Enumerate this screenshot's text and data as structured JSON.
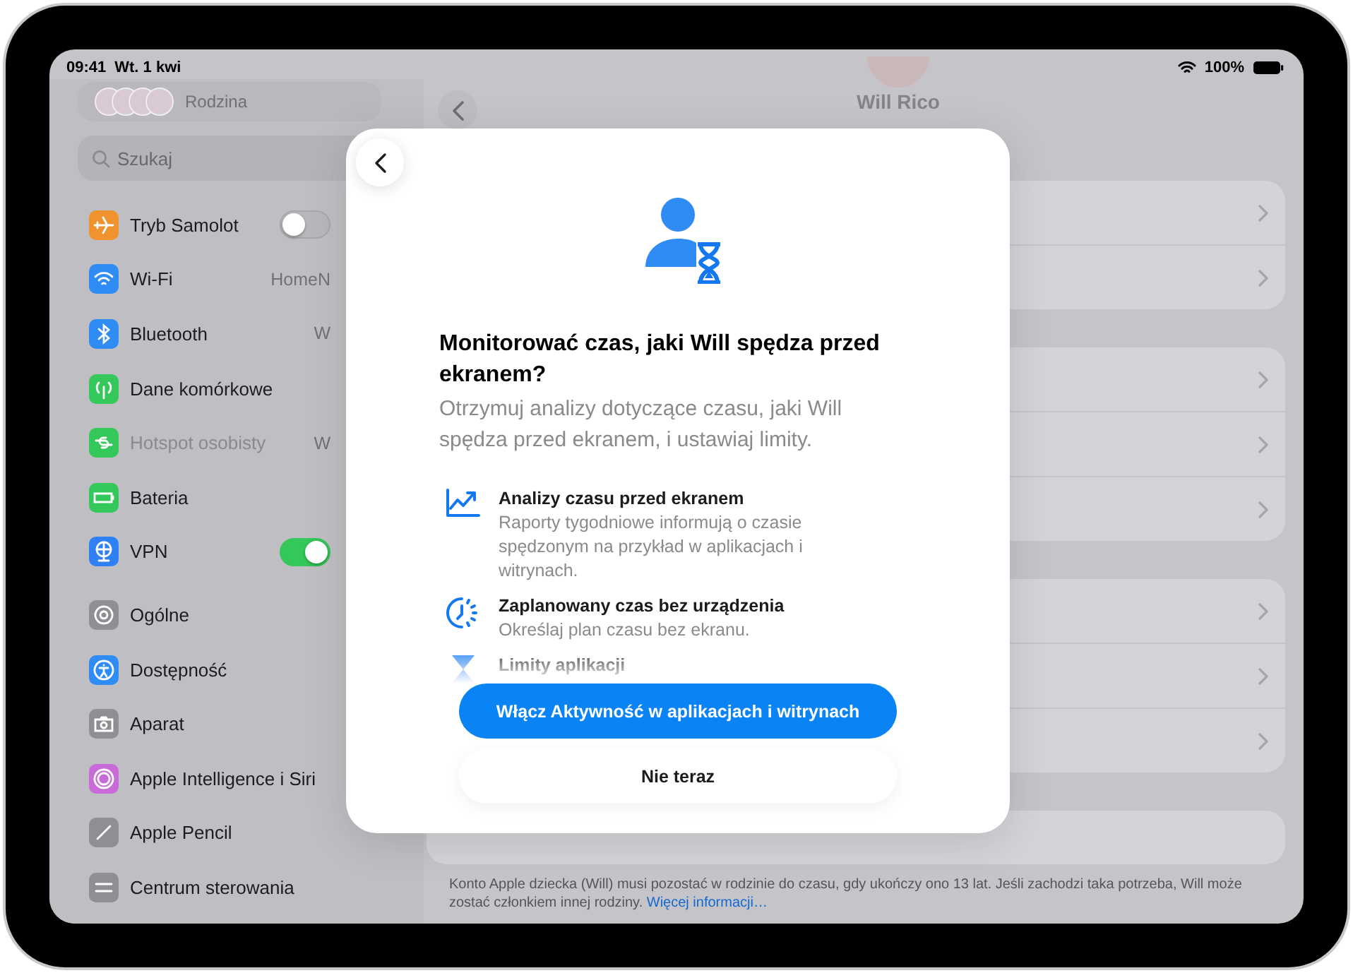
{
  "status_bar": {
    "time": "09:41",
    "date": "Wt. 1 kwi",
    "battery": "100%"
  },
  "sidebar": {
    "family": "Rodzina",
    "search": {
      "placeholder": "Szukaj"
    },
    "groups": [
      [
        {
          "label": "Tryb Samolot",
          "kind": "toggle",
          "on": false,
          "disabled": false,
          "color": "#f0922e"
        },
        {
          "label": "Wi-Fi",
          "kind": "value",
          "value": "HomeN",
          "disabled": false,
          "color": "#2f8cf5"
        },
        {
          "label": "Bluetooth",
          "kind": "value",
          "value": "W",
          "disabled": false,
          "color": "#2f8cf5"
        },
        {
          "label": "Dane komórkowe",
          "kind": "link",
          "disabled": false,
          "color": "#34c759"
        },
        {
          "label": "Hotspot osobisty",
          "kind": "value",
          "value": "W",
          "disabled": true,
          "color": "#34c759"
        },
        {
          "label": "Bateria",
          "kind": "link",
          "disabled": false,
          "color": "#34c759"
        },
        {
          "label": "VPN",
          "kind": "toggle",
          "on": true,
          "disabled": false,
          "color": "#2f7ff5"
        }
      ],
      [
        {
          "label": "Ogólne",
          "kind": "link",
          "disabled": false,
          "color": "#8e8e93"
        },
        {
          "label": "Dostępność",
          "kind": "link",
          "disabled": false,
          "color": "#2f8cf5"
        },
        {
          "label": "Aparat",
          "kind": "link",
          "disabled": false,
          "color": "#8e8e93"
        },
        {
          "label": "Apple Intelligence i Siri",
          "kind": "link",
          "disabled": false,
          "color": "#c86ad8"
        },
        {
          "label": "Apple Pencil",
          "kind": "link",
          "disabled": false,
          "color": "#8e8e93"
        },
        {
          "label": "Centrum sterowania",
          "kind": "link",
          "disabled": false,
          "color": "#8e8e93"
        }
      ]
    ]
  },
  "detail": {
    "name": "Will Rico",
    "groups": [
      [
        {
          "kind": "link"
        },
        {
          "kind": "link"
        }
      ],
      [
        {
          "kind": "link"
        },
        {
          "kind": "link"
        },
        {
          "kind": "link"
        }
      ],
      [
        {
          "kind": "link"
        },
        {
          "kind": "link"
        },
        {
          "kind": "link"
        }
      ],
      [
        {
          "kind": "plain"
        }
      ]
    ],
    "footer": "Konto Apple dziecka (Will) musi pozostać w rodzinie do czasu, gdy ukończy ono 13 lat. Jeśli zachodzi taka potrzeba, Will może zostać członkiem innej rodziny.",
    "footer_link": "Więcej informacji…"
  },
  "modal": {
    "title": "Monitorować czas, jaki Will spędza przed ekranem?",
    "subtitle": "Otrzymuj analizy dotyczące czasu, jaki Will spędza przed ekranem, i ustawiaj limity.",
    "features": [
      {
        "kind": "chart",
        "title": "Analizy czasu przed ekranem",
        "text": "Raporty tygodniowe informują o czasie spędzonym na przykład w aplikacjach i witrynach."
      },
      {
        "kind": "clock",
        "title": "Zaplanowany czas bez urządzenia",
        "text": "Określaj plan czasu bez ekranu."
      },
      {
        "kind": "hourglass",
        "title": "Limity aplikacji"
      }
    ],
    "primary_button": "Włącz Aktywność w aplikacjach i witrynach",
    "secondary_button": "Nie teraz"
  }
}
